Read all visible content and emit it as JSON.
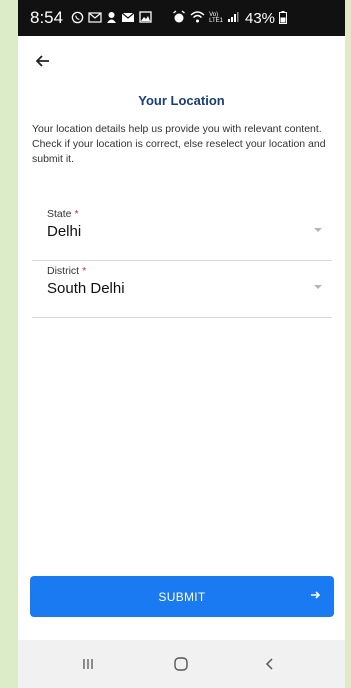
{
  "status_bar": {
    "time": "8:54",
    "left_icons": [
      "whatsapp-icon",
      "gmail-icon",
      "app-icon",
      "mail-icon",
      "gallery-icon"
    ],
    "right_icons": [
      "alarm-icon",
      "wifi-icon",
      "volte-icon",
      "signal-icon"
    ],
    "volte_text": "Vo)\nLTE1",
    "battery": "43%"
  },
  "header": {
    "back_icon": "back-arrow-icon"
  },
  "page": {
    "title": "Your Location",
    "description": "Your location details help us provide you with relevant content. Check if your location is correct, else reselect your location and submit it."
  },
  "form": {
    "state": {
      "label": "State",
      "required_mark": "*",
      "value": "Delhi"
    },
    "district": {
      "label": "District",
      "required_mark": "*",
      "value": "South Delhi"
    }
  },
  "submit": {
    "label": "SUBMIT",
    "icon": "arrow-right-icon"
  },
  "nav_bar": {
    "items": [
      "recents-icon",
      "home-icon",
      "back-icon"
    ]
  },
  "colors": {
    "background": "#dcebc8",
    "title": "#1a3d7c",
    "required": "#d32f2f",
    "button": "#1a7af1"
  }
}
